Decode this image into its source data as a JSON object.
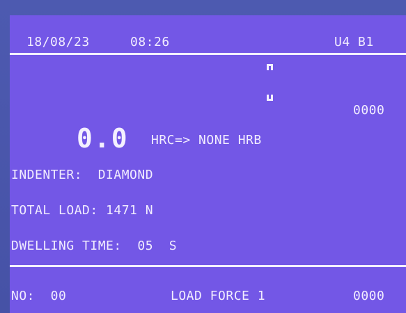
{
  "status_bar": {
    "date": "18/08/23",
    "time": "08:26",
    "unit_code": "U4 B1"
  },
  "reading": {
    "value": "0.0",
    "scale_conversion": "HRC=> NONE HRB",
    "right_counter": "0000"
  },
  "settings": {
    "indenter": "INDENTER:  DIAMOND",
    "total_load": "TOTAL LOAD: 1471 N",
    "dwelling_time": "DWELLING TIME:  05  S"
  },
  "footer": {
    "test_no": "NO:  00",
    "load_force": "LOAD FORCE 1",
    "counter": "0000"
  },
  "icons": {
    "upper_marker": "top-bracket-icon",
    "lower_marker": "bottom-bracket-icon"
  },
  "colors": {
    "screen_bg": "#7357e6",
    "text": "#f1ecff",
    "bezel": "#4a56a8"
  }
}
